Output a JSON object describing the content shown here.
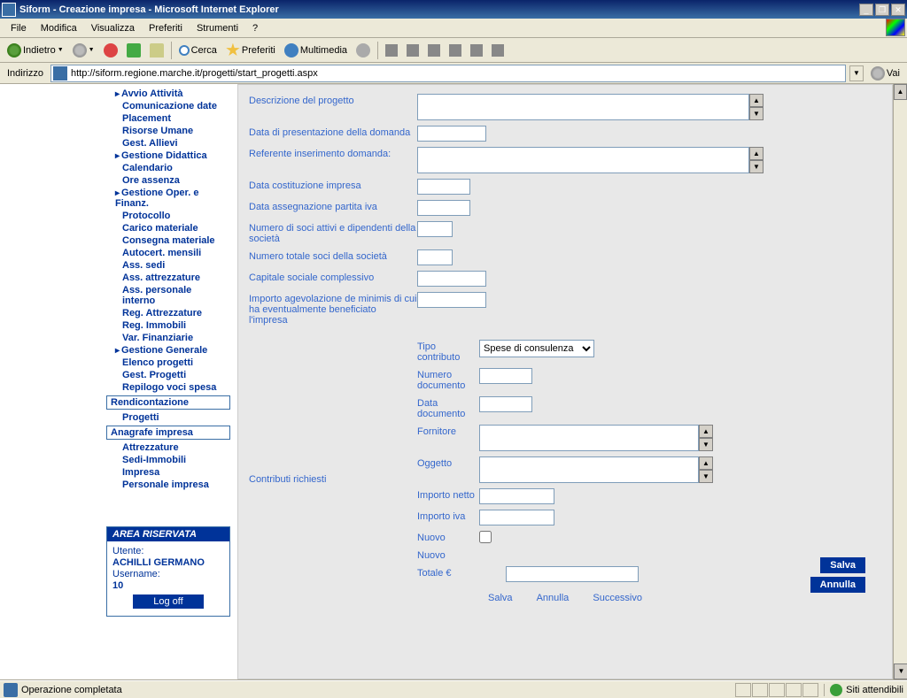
{
  "window": {
    "title": "Siform - Creazione impresa - Microsoft Internet Explorer"
  },
  "menubar": {
    "file": "File",
    "modifica": "Modifica",
    "visualizza": "Visualizza",
    "preferiti": "Preferiti",
    "strumenti": "Strumenti",
    "help": "?"
  },
  "toolbar": {
    "indietro": "Indietro",
    "cerca": "Cerca",
    "preferiti": "Preferiti",
    "multimedia": "Multimedia"
  },
  "addressbar": {
    "label": "Indirizzo",
    "url": "http://siform.regione.marche.it/progetti/start_progetti.aspx",
    "go": "Vai"
  },
  "sidebar": {
    "items": [
      "Avvio Attività",
      "Comunicazione date",
      "Placement",
      "Risorse Umane",
      "Gest. Allievi",
      "Gestione Didattica",
      "Calendario",
      "Ore assenza",
      "Gestione Oper. e Finanz.",
      "Protocollo",
      "Carico materiale",
      "Consegna materiale",
      "Autocert. mensili",
      "Ass. sedi",
      "Ass. attrezzature",
      "Ass. personale interno",
      "Reg. Attrezzature",
      "Reg. Immobili",
      "Var. Finanziarie",
      "Gestione Generale",
      "Elenco progetti",
      "Gest. Progetti",
      "Repilogo voci spesa"
    ],
    "rendicontazione": "Rendicontazione",
    "progetti": "Progetti",
    "anagrafe": "Anagrafe impresa",
    "anagrafe_items": [
      "Attrezzature",
      "Sedi-Immobili",
      "Impresa",
      "Personale impresa"
    ]
  },
  "reserved": {
    "title": "AREA RISERVATA",
    "utente_label": "Utente:",
    "utente_value": "ACHILLI GERMANO",
    "username_label": "Username:",
    "username_value": "10",
    "logoff": "Log off"
  },
  "form": {
    "descrizione": "Descrizione del progetto",
    "data_presentazione": "Data di presentazione della domanda",
    "referente": "Referente inserimento domanda:",
    "data_costituzione": "Data costituzione impresa",
    "data_partita_iva": "Data assegnazione partita iva",
    "numero_soci_attivi": "Numero di  soci attivi e dipendenti della società",
    "numero_totale_soci": "Numero totale soci della società",
    "capitale_sociale": "Capitale sociale complessivo",
    "importo_agevolazione": "Importo  agevolazione de minimis di cui  ha  eventualmente beneficiato l'impresa",
    "contributi_richiesti": "Contributi richiesti",
    "tipo_contributo": "Tipo contributo",
    "tipo_contributo_value": "Spese di consulenza",
    "numero_documento": "Numero documento",
    "data_documento": "Data documento",
    "fornitore": "Fornitore",
    "oggetto": "Oggetto",
    "importo_netto": "Importo netto",
    "importo_iva": "Importo iva",
    "nuovo_check": "Nuovo",
    "nuovo_link": "Nuovo",
    "totale": "Totale €",
    "salva": "Salva",
    "annulla": "Annulla"
  },
  "bottom_actions": {
    "salva": "Salva",
    "annulla": "Annulla",
    "successivo": "Successivo"
  },
  "statusbar": {
    "text": "Operazione completata",
    "trust": "Siti attendibili"
  }
}
